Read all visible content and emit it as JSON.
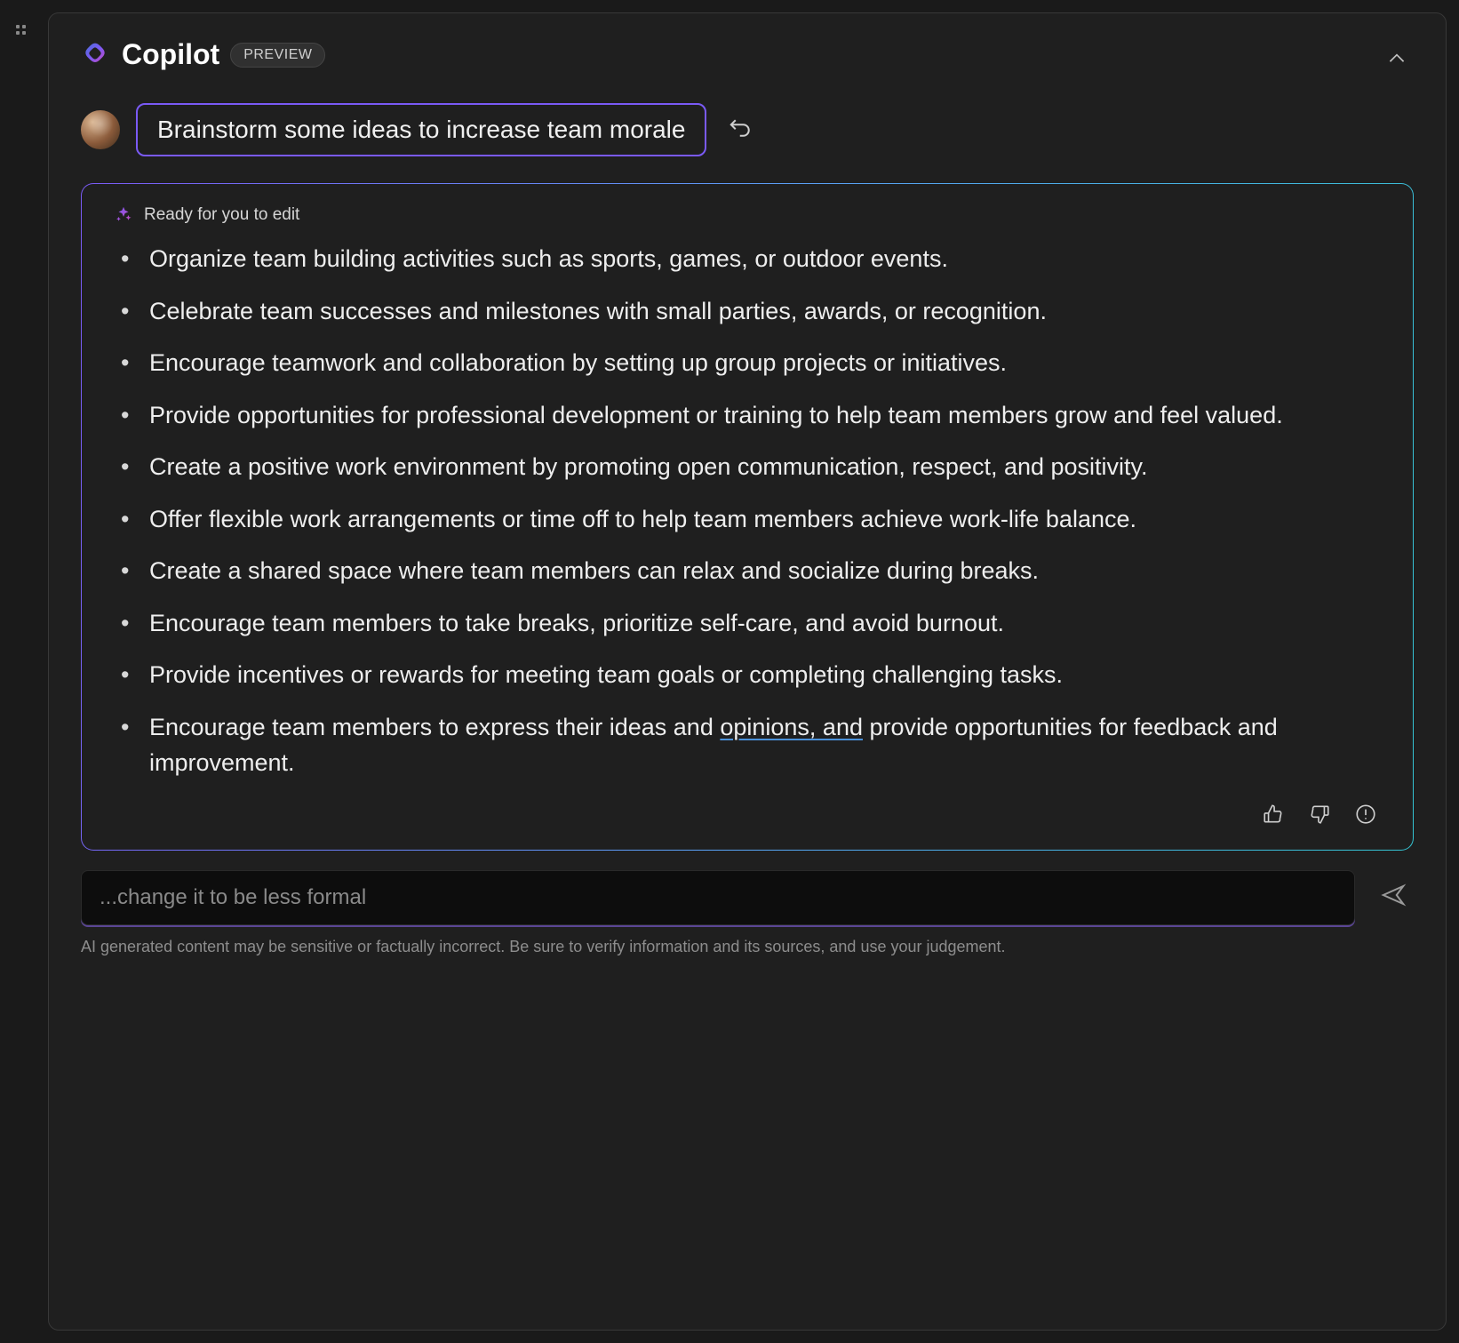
{
  "header": {
    "brand": "Copilot",
    "badge": "PREVIEW"
  },
  "prompt": {
    "text": "Brainstorm some ideas to increase team morale"
  },
  "response": {
    "ready_label": "Ready for you to edit",
    "items": [
      "Organize team building activities such as sports, games, or outdoor events.",
      "Celebrate team successes and milestones with small parties, awards, or recognition.",
      "Encourage teamwork and collaboration by setting up group projects or initiatives.",
      "Provide opportunities for professional development or training to help team members grow and feel valued.",
      "Create a positive work environment by promoting open communication, respect, and positivity.",
      "Offer flexible work arrangements or time off to help team members achieve work-life balance.",
      "Create a shared space where team members can relax and socialize during breaks.",
      "Encourage team members to take breaks, prioritize self-care, and avoid burnout.",
      "Provide incentives or rewards for meeting team goals or completing challenging tasks.",
      "Encourage team members to express their ideas and opinions, and provide opportunities for feedback and improvement."
    ],
    "underlined_item_index": 9,
    "underlined_phrase": "opinions, and"
  },
  "input": {
    "placeholder": "...change it to be less formal",
    "value": ""
  },
  "disclaimer": "AI generated content may be sensitive or factually incorrect. Be sure to verify information and its sources, and use your judgement."
}
